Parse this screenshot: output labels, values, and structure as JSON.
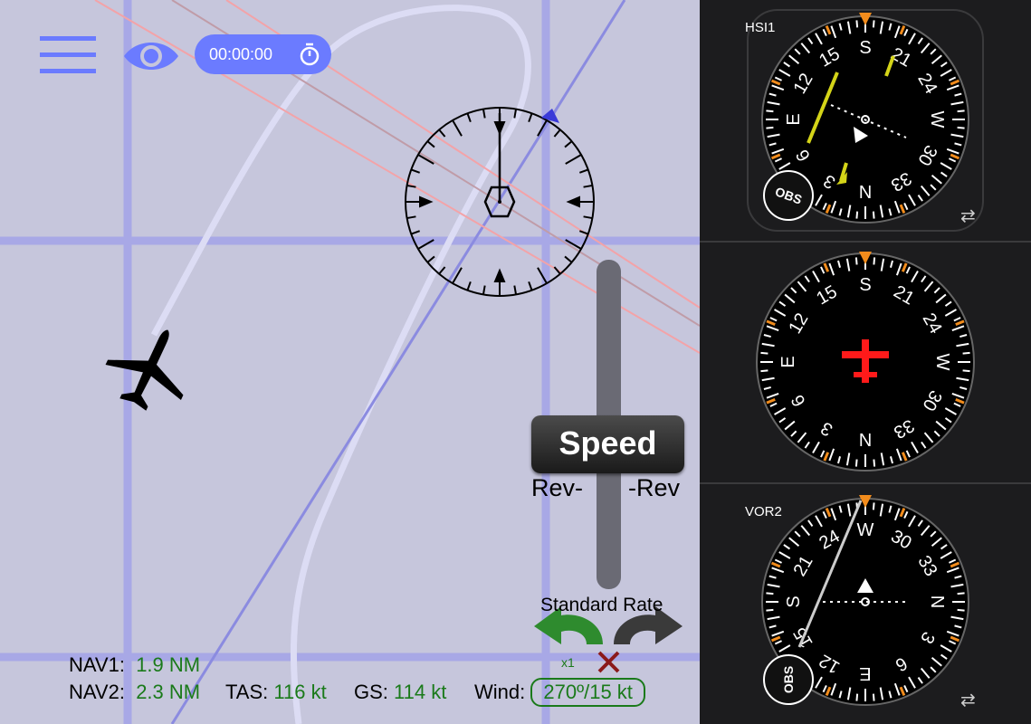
{
  "map": {
    "timer": "00:00:00",
    "speed_button": "Speed",
    "rev_left": "Rev-",
    "rev_right": "-Rev",
    "standard_rate": "Standard Rate",
    "rate_multiplier": "x1"
  },
  "status": {
    "nav1_label": "NAV1:",
    "nav1_value": "1.9 NM",
    "nav2_label": "NAV2:",
    "nav2_value": "2.3 NM",
    "tas_label": "TAS:",
    "tas_value": "116 kt",
    "gs_label": "GS:",
    "gs_value": "114 kt",
    "wind_label": "Wind:",
    "wind_value": "270º/15 kt"
  },
  "instruments": {
    "hsi": {
      "label": "HSI1",
      "obs": "OBS",
      "card_labels": [
        "S",
        "21",
        "24",
        "W",
        "30",
        "33",
        "N",
        "3",
        "6",
        "E",
        "12",
        "15"
      ]
    },
    "heading": {
      "card_labels": [
        "S",
        "21",
        "24",
        "W",
        "30",
        "33",
        "N",
        "3",
        "6",
        "E",
        "12",
        "15"
      ]
    },
    "vor": {
      "label": "VOR2",
      "obs": "OBS",
      "card_labels": [
        "W",
        "30",
        "33",
        "N",
        "3",
        "6",
        "E",
        "12",
        "15",
        "S",
        "21",
        "24"
      ]
    }
  },
  "colors": {
    "accent": "#6b7bff",
    "value_green": "#1a7a1a",
    "course_yellow": "#d4d418",
    "lubber_orange": "#f28c1c",
    "aircraft_red": "#ff1a1a"
  }
}
